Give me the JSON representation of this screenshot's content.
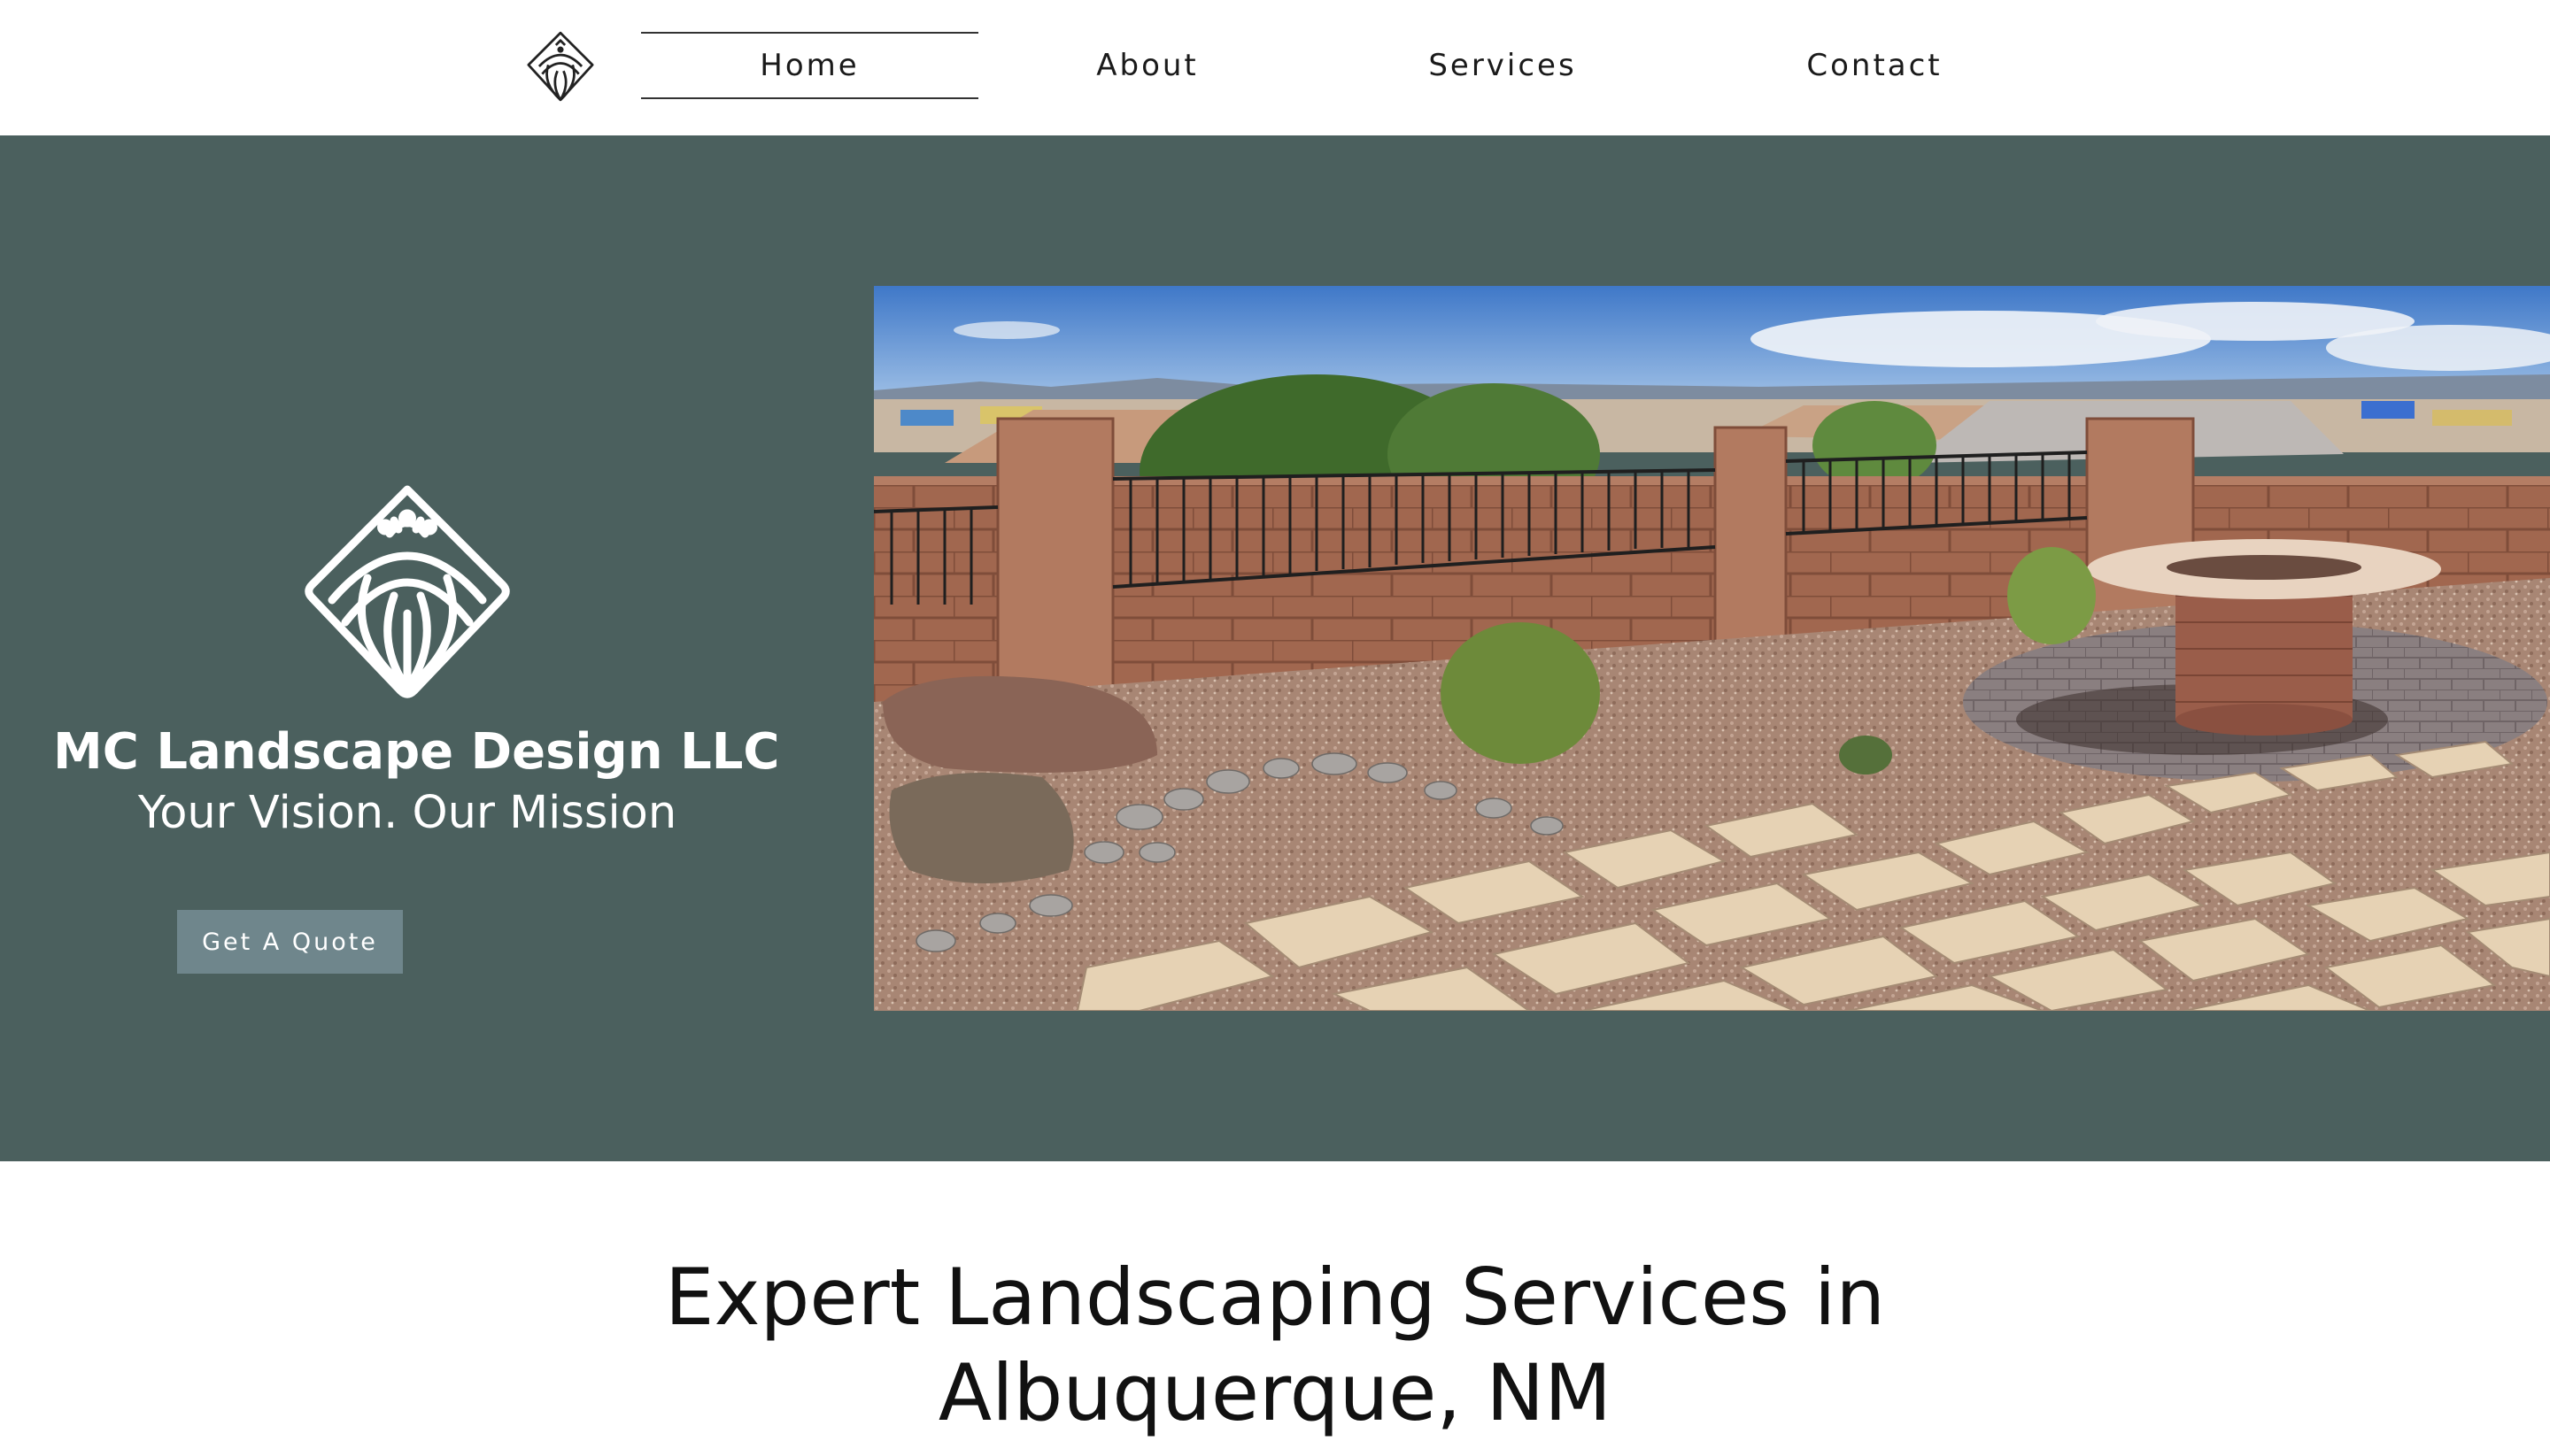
{
  "header": {
    "logo_icon": "mc-landscape-logo-icon",
    "nav": [
      {
        "label": "Home",
        "active": true
      },
      {
        "label": "About",
        "active": false
      },
      {
        "label": "Services",
        "active": false
      },
      {
        "label": "Contact",
        "active": false
      }
    ]
  },
  "hero": {
    "background_color": "#4b605e",
    "logo_icon": "mc-landscape-logo-icon",
    "company_name": "MC Landscape Design LLC",
    "tagline": "Your Vision. Our Mission",
    "cta_label": "Get A Quote",
    "cta_color": "#6f868c",
    "photo": "backyard-landscape-photo"
  },
  "intro": {
    "heading": "Expert Landscaping Services in Albuquerque, NM"
  }
}
